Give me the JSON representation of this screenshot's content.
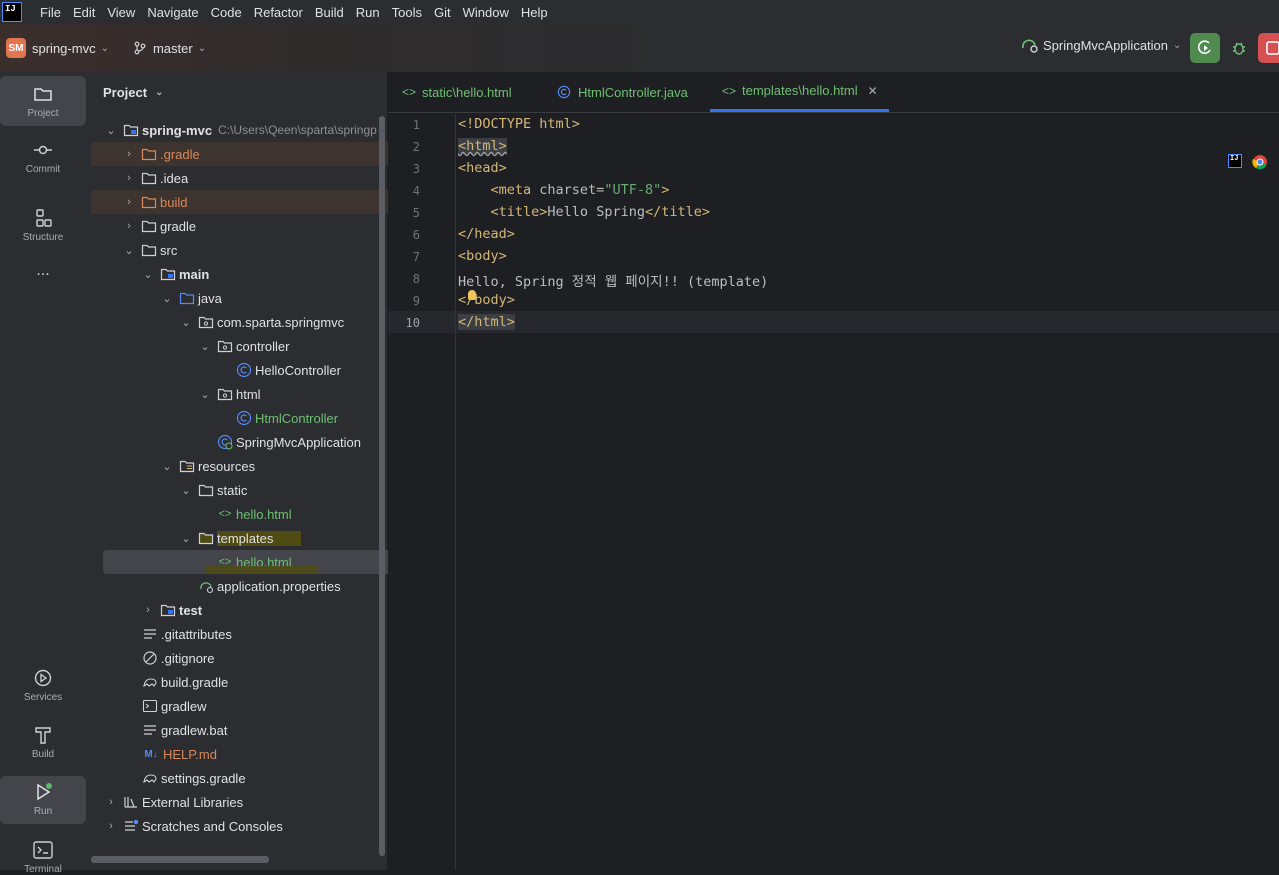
{
  "menu": {
    "logo": "IJ",
    "items": [
      "File",
      "Edit",
      "View",
      "Navigate",
      "Code",
      "Refactor",
      "Build",
      "Run",
      "Tools",
      "Git",
      "Window",
      "Help"
    ]
  },
  "toolbar": {
    "project_badge": "SM",
    "project_name": "spring-mvc",
    "branch": "master",
    "run_config": "SpringMvcApplication"
  },
  "toolstrip": {
    "project": "Project",
    "commit": "Commit",
    "structure": "Structure",
    "more": "...",
    "services": "Services",
    "build": "Build",
    "run": "Run",
    "terminal": "Terminal"
  },
  "project_panel": {
    "title": "Project",
    "root_name": "spring-mvc",
    "root_path": "C:\\Users\\Qeen\\sparta\\springp",
    "tree": [
      {
        "label": ".gradle"
      },
      {
        "label": ".idea"
      },
      {
        "label": "build"
      },
      {
        "label": "gradle"
      },
      {
        "label": "src"
      },
      {
        "label": "main"
      },
      {
        "label": "java"
      },
      {
        "label": "com.sparta.springmvc"
      },
      {
        "label": "controller"
      },
      {
        "label": "HelloController"
      },
      {
        "label": "html"
      },
      {
        "label": "HtmlController"
      },
      {
        "label": "SpringMvcApplication"
      },
      {
        "label": "resources"
      },
      {
        "label": "static"
      },
      {
        "label": "hello.html"
      },
      {
        "label": "templates"
      },
      {
        "label": "hello.html"
      },
      {
        "label": "application.properties"
      },
      {
        "label": "test"
      },
      {
        "label": ".gitattributes"
      },
      {
        "label": ".gitignore"
      },
      {
        "label": "build.gradle"
      },
      {
        "label": "gradlew"
      },
      {
        "label": "gradlew.bat"
      },
      {
        "label": "HELP.md"
      },
      {
        "label": "settings.gradle"
      },
      {
        "label": "External Libraries"
      },
      {
        "label": "Scratches and Consoles"
      }
    ]
  },
  "editor": {
    "tabs": [
      {
        "label": "static\\hello.html"
      },
      {
        "label": "HtmlController.java"
      },
      {
        "label": "templates\\hello.html"
      }
    ],
    "line_numbers": [
      "1",
      "2",
      "3",
      "4",
      "5",
      "6",
      "7",
      "8",
      "9",
      "10"
    ],
    "code": {
      "l1_a": "<!DOCTYPE",
      "l1_b": " html>",
      "l2": "<html>",
      "l3": "<head>",
      "l4_indent": "    ",
      "l4_open": "<meta ",
      "l4_attr": "charset=",
      "l4_val": "\"UTF-8\"",
      "l4_close": ">",
      "l5_indent": "    ",
      "l5_open": "<title>",
      "l5_text": "Hello Spring",
      "l5_close": "</title>",
      "l6": "</head>",
      "l7": "<body>",
      "l8": "Hello, Spring 정적 웹 페이지!! (template)",
      "l9_a": "<",
      "l9_b": "/body>",
      "l10": "</html>"
    }
  },
  "colors": {
    "accent": "#3574f0",
    "excluded_folder": "#d9895a",
    "html_file": "#6fbf73",
    "tag": "#d5b778",
    "string": "#6aab73",
    "run_button": "#4f8a4f",
    "stop_button": "#d55151"
  }
}
